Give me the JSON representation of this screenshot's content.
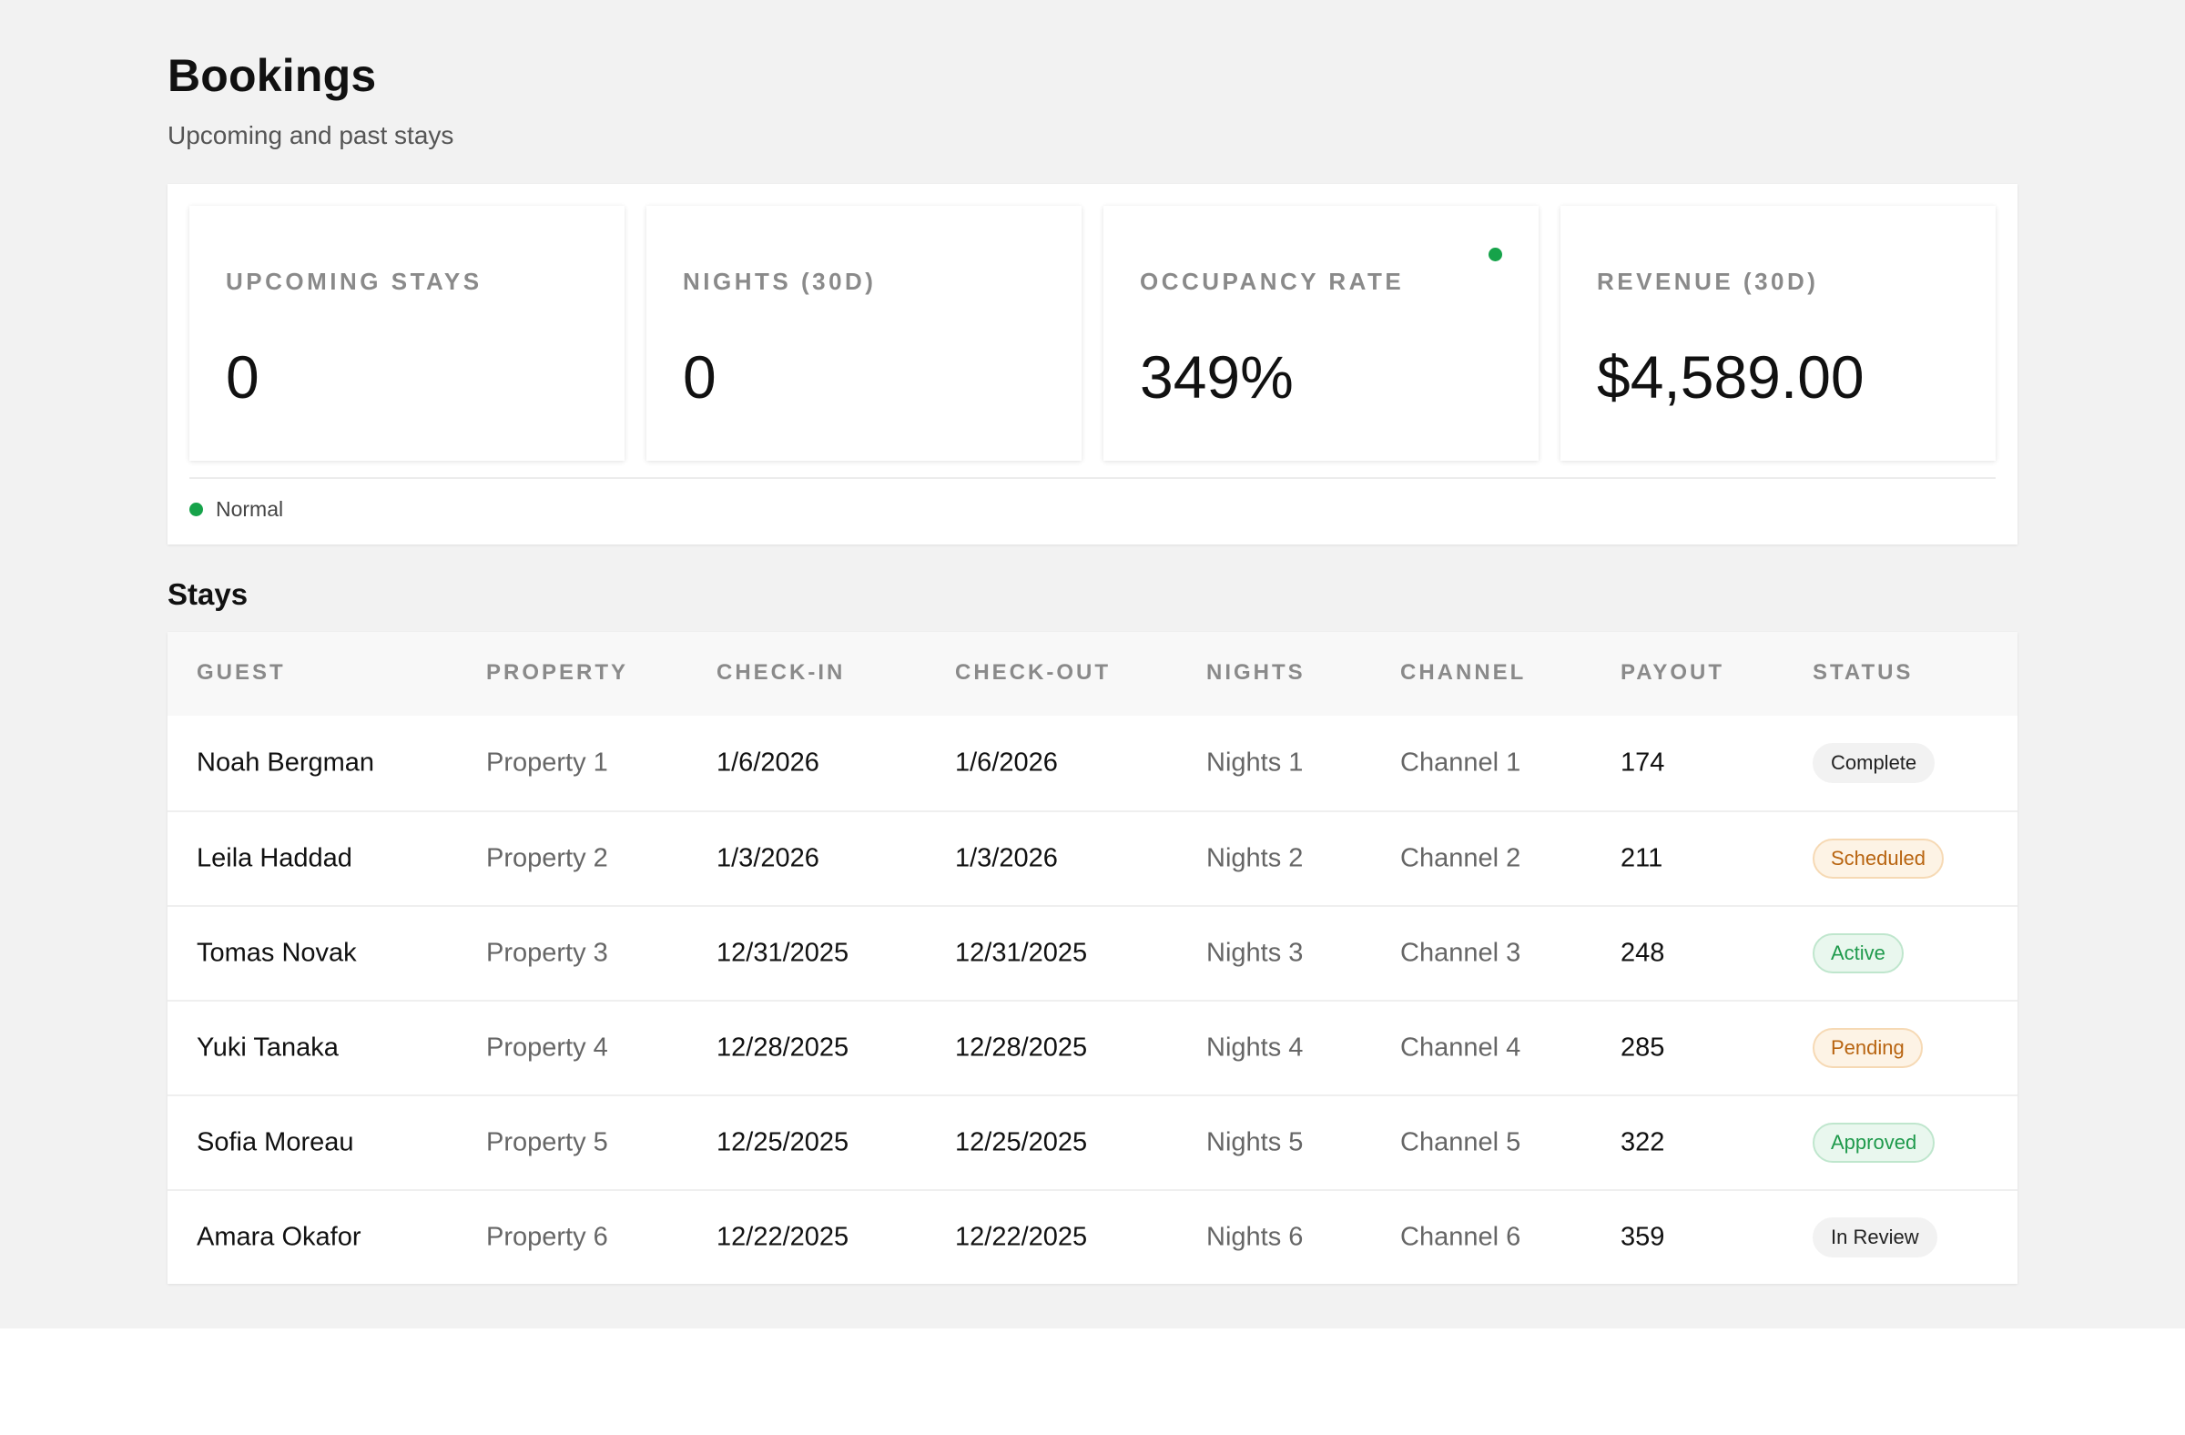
{
  "header": {
    "title": "Bookings",
    "subtitle": "Upcoming and past stays"
  },
  "stats": [
    {
      "label": "UPCOMING STAYS",
      "value": "0",
      "indicator": false
    },
    {
      "label": "NIGHTS (30D)",
      "value": "0",
      "indicator": false
    },
    {
      "label": "OCCUPANCY RATE",
      "value": "349%",
      "indicator": true
    },
    {
      "label": "REVENUE (30D)",
      "value": "$4,589.00",
      "indicator": false
    }
  ],
  "legend": {
    "label": "Normal"
  },
  "colors": {
    "status_green": "#16a34a",
    "warning_text": "#b86410",
    "success_text": "#1f9a4c"
  },
  "stays": {
    "title": "Stays",
    "columns": [
      "GUEST",
      "PROPERTY",
      "CHECK-IN",
      "CHECK-OUT",
      "NIGHTS",
      "CHANNEL",
      "PAYOUT",
      "STATUS"
    ],
    "rows": [
      {
        "guest": "Noah Bergman",
        "property": "Property 1",
        "check_in": "1/6/2026",
        "check_out": "1/6/2026",
        "nights": "Nights 1",
        "channel": "Channel 1",
        "payout": "174",
        "status": "Complete",
        "tone": "neutral"
      },
      {
        "guest": "Leila Haddad",
        "property": "Property 2",
        "check_in": "1/3/2026",
        "check_out": "1/3/2026",
        "nights": "Nights 2",
        "channel": "Channel 2",
        "payout": "211",
        "status": "Scheduled",
        "tone": "warn"
      },
      {
        "guest": "Tomas Novak",
        "property": "Property 3",
        "check_in": "12/31/2025",
        "check_out": "12/31/2025",
        "nights": "Nights 3",
        "channel": "Channel 3",
        "payout": "248",
        "status": "Active",
        "tone": "success"
      },
      {
        "guest": "Yuki Tanaka",
        "property": "Property 4",
        "check_in": "12/28/2025",
        "check_out": "12/28/2025",
        "nights": "Nights 4",
        "channel": "Channel 4",
        "payout": "285",
        "status": "Pending",
        "tone": "warn"
      },
      {
        "guest": "Sofia Moreau",
        "property": "Property 5",
        "check_in": "12/25/2025",
        "check_out": "12/25/2025",
        "nights": "Nights 5",
        "channel": "Channel 5",
        "payout": "322",
        "status": "Approved",
        "tone": "success"
      },
      {
        "guest": "Amara Okafor",
        "property": "Property 6",
        "check_in": "12/22/2025",
        "check_out": "12/22/2025",
        "nights": "Nights 6",
        "channel": "Channel 6",
        "payout": "359",
        "status": "In Review",
        "tone": "neutral"
      }
    ]
  }
}
